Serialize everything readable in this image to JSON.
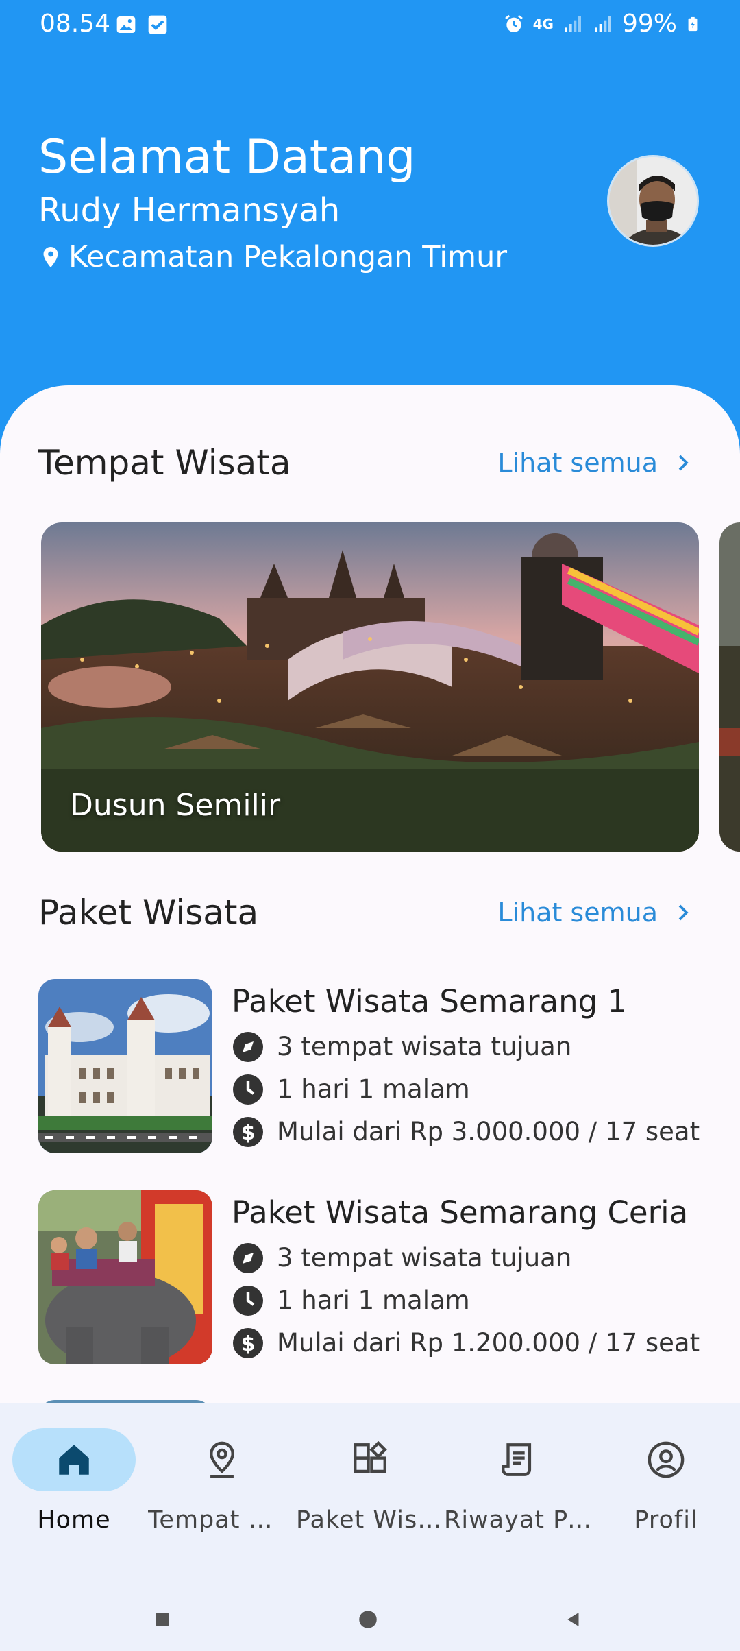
{
  "status_bar": {
    "time": "08.54",
    "network": "4G",
    "battery": "99%"
  },
  "header": {
    "greeting": "Selamat Datang",
    "user_name": "Rudy Hermansyah",
    "location": "Kecamatan Pekalongan Timur"
  },
  "tempat_wisata": {
    "title": "Tempat Wisata",
    "see_all": "Lihat semua",
    "cards": [
      {
        "name": "Dusun Semilir"
      }
    ]
  },
  "paket_wisata": {
    "title": "Paket Wisata",
    "see_all": "Lihat semua",
    "items": [
      {
        "title": "Paket Wisata Semarang 1",
        "destinations": "3 tempat wisata tujuan",
        "duration": "1 hari 1 malam",
        "price": "Mulai dari Rp 3.000.000 / 17 seat"
      },
      {
        "title": "Paket Wisata Semarang Ceria",
        "destinations": "3 tempat wisata tujuan",
        "duration": "1 hari 1 malam",
        "price": "Mulai dari Rp 1.200.000 / 17 seat"
      }
    ]
  },
  "bottom_nav": {
    "items": [
      {
        "label": "Home",
        "icon": "home-icon",
        "active": true
      },
      {
        "label": "Tempat Wis...",
        "icon": "location-pin-icon",
        "active": false
      },
      {
        "label": "Paket Wisata",
        "icon": "widgets-icon",
        "active": false
      },
      {
        "label": "Riwayat Pe...",
        "icon": "receipt-icon",
        "active": false
      },
      {
        "label": "Profil",
        "icon": "profile-icon",
        "active": false
      }
    ]
  },
  "colors": {
    "primary": "#2196f3",
    "accent_text": "#2a8bd8",
    "nav_active": "#b7e0fb",
    "nav_background": "#edf1fb",
    "surface": "#fcf9fd"
  }
}
